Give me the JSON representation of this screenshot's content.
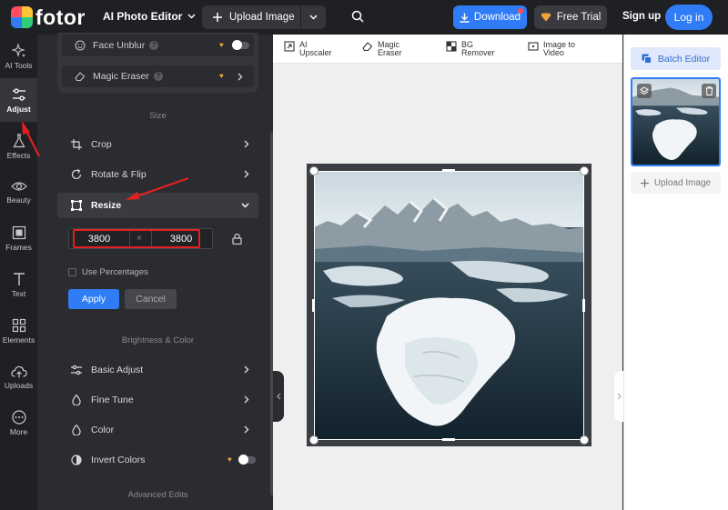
{
  "app": {
    "logo_text": "fotor",
    "editor_name": "AI Photo Editor"
  },
  "topbar": {
    "upload_label": "Upload Image",
    "download_label": "Download",
    "trial_label": "Free Trial",
    "signup_label": "Sign up",
    "login_label": "Log in"
  },
  "rail": {
    "items": [
      {
        "label": "AI Tools",
        "icon": "sparkle-icon"
      },
      {
        "label": "Adjust",
        "icon": "sliders-icon",
        "active": true
      },
      {
        "label": "Effects",
        "icon": "flask-icon"
      },
      {
        "label": "Beauty",
        "icon": "eye-icon"
      },
      {
        "label": "Frames",
        "icon": "frame-icon"
      },
      {
        "label": "Text",
        "icon": "text-icon"
      },
      {
        "label": "Elements",
        "icon": "shapes-icon"
      },
      {
        "label": "Uploads",
        "icon": "cloud-upload-icon"
      },
      {
        "label": "More",
        "icon": "more-icon"
      }
    ]
  },
  "panel": {
    "face_unblur": "Face Unblur",
    "magic_eraser": "Magic Eraser",
    "size_section": "Size",
    "crop": "Crop",
    "rotate_flip": "Rotate & Flip",
    "resize": "Resize",
    "width_value": "3800",
    "height_value": "3800",
    "times_symbol": "×",
    "use_percentages": "Use Percentages",
    "apply": "Apply",
    "cancel": "Cancel",
    "brightness_section": "Brightness & Color",
    "basic_adjust": "Basic Adjust",
    "fine_tune": "Fine Tune",
    "color": "Color",
    "invert_colors": "Invert Colors",
    "advanced_section": "Advanced Edits"
  },
  "tools": {
    "ai_upscaler": [
      "AI",
      "Upscaler"
    ],
    "magic_eraser": [
      "Magic",
      "Eraser"
    ],
    "bg_remover": [
      "BG",
      "Remover"
    ],
    "image_to_video": [
      "Image to",
      "Video"
    ]
  },
  "right_panel": {
    "batch_editor": "Batch Editor",
    "upload_image": "Upload Image"
  },
  "colors": {
    "accent": "#2f7cf6",
    "annotation": "#e52020",
    "dark_bg": "#1f2023",
    "panel_bg": "#2b2c30"
  }
}
